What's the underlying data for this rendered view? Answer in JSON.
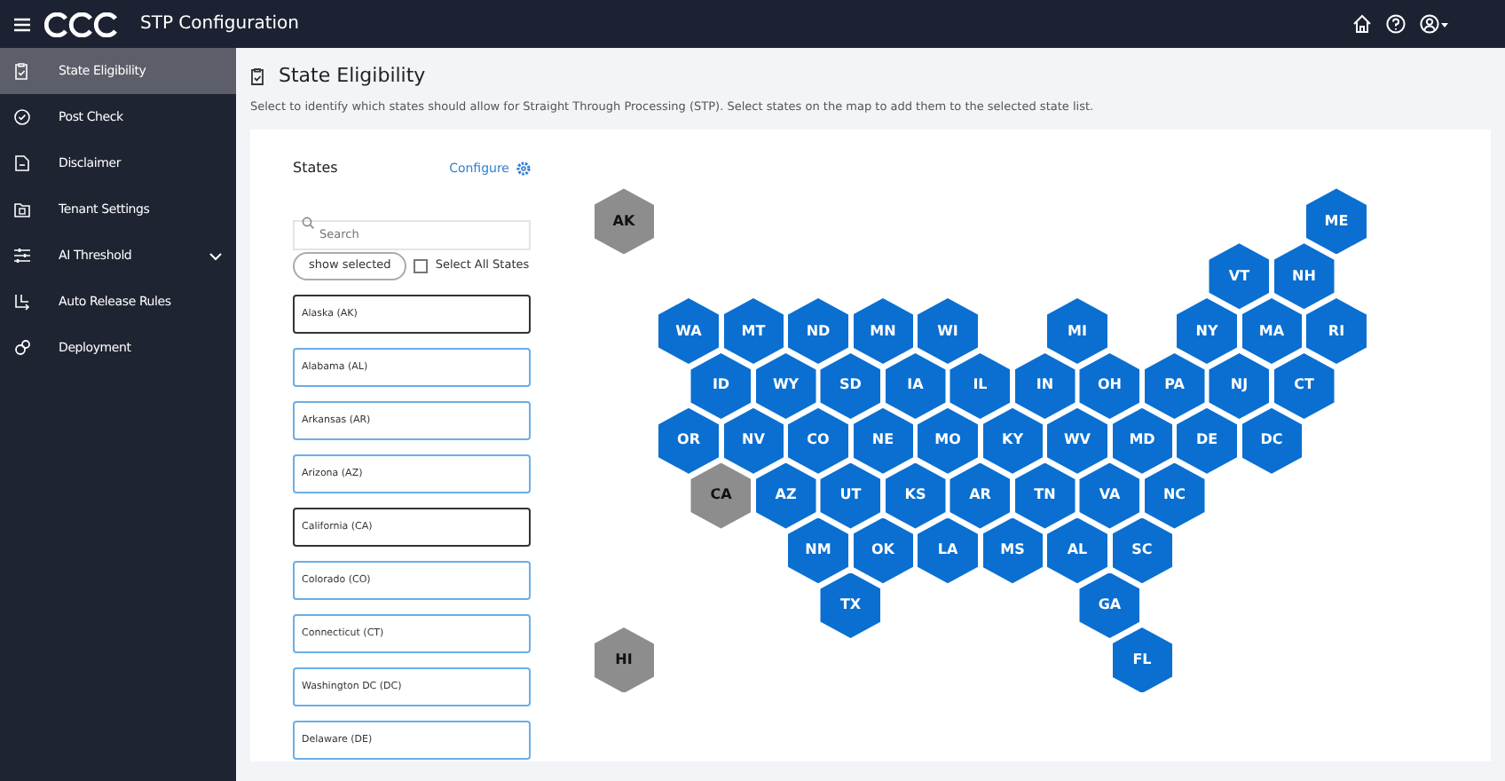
{
  "header": {
    "title": "STP Configuration"
  },
  "sidebar": {
    "items": [
      {
        "label": "State Eligibility",
        "selected": true
      },
      {
        "label": "Post Check",
        "selected": false
      },
      {
        "label": "Disclaimer",
        "selected": false
      },
      {
        "label": "Tenant Settings",
        "selected": false
      },
      {
        "label": "AI Threshold",
        "selected": false,
        "expanded": false
      },
      {
        "label": "Auto Release Rules",
        "selected": false
      },
      {
        "label": "Deployment",
        "selected": false
      }
    ]
  },
  "page": {
    "title": "State Eligibility",
    "description": "Select to identify which states should allow for Straight Through Processing (STP). Select states on the map to add them to the selected state list."
  },
  "states_panel": {
    "title": "States",
    "configure_link": "Configure",
    "search": {
      "placeholder": "Search"
    },
    "show_selected_button": "show selected",
    "select_all": {
      "label": "Select All States",
      "checked": false
    },
    "items": [
      {
        "label": "Alaska (AK)",
        "selected": false
      },
      {
        "label": "Alabama (AL)",
        "selected": true
      },
      {
        "label": "Arkansas (AR)",
        "selected": true
      },
      {
        "label": "Arizona (AZ)",
        "selected": true
      },
      {
        "label": "California (CA)",
        "selected": false
      },
      {
        "label": "Colorado (CO)",
        "selected": true
      },
      {
        "label": "Connecticut (CT)",
        "selected": true
      },
      {
        "label": "Washington DC (DC)",
        "selected": true
      },
      {
        "label": "Delaware (DE)",
        "selected": true
      }
    ]
  },
  "map": {
    "tiles": [
      {
        "code": "AK",
        "selected": false
      },
      {
        "code": "ME",
        "selected": true
      },
      {
        "code": "VT",
        "selected": true
      },
      {
        "code": "NH",
        "selected": true
      },
      {
        "code": "WA",
        "selected": true
      },
      {
        "code": "MT",
        "selected": true
      },
      {
        "code": "ND",
        "selected": true
      },
      {
        "code": "MN",
        "selected": true
      },
      {
        "code": "WI",
        "selected": true
      },
      {
        "code": "MI",
        "selected": true
      },
      {
        "code": "NY",
        "selected": true
      },
      {
        "code": "MA",
        "selected": true
      },
      {
        "code": "RI",
        "selected": true
      },
      {
        "code": "ID",
        "selected": true
      },
      {
        "code": "WY",
        "selected": true
      },
      {
        "code": "SD",
        "selected": true
      },
      {
        "code": "IA",
        "selected": true
      },
      {
        "code": "IL",
        "selected": true
      },
      {
        "code": "IN",
        "selected": true
      },
      {
        "code": "OH",
        "selected": true
      },
      {
        "code": "PA",
        "selected": true
      },
      {
        "code": "NJ",
        "selected": true
      },
      {
        "code": "CT",
        "selected": true
      },
      {
        "code": "OR",
        "selected": true
      },
      {
        "code": "NV",
        "selected": true
      },
      {
        "code": "CO",
        "selected": true
      },
      {
        "code": "NE",
        "selected": true
      },
      {
        "code": "MO",
        "selected": true
      },
      {
        "code": "KY",
        "selected": true
      },
      {
        "code": "WV",
        "selected": true
      },
      {
        "code": "MD",
        "selected": true
      },
      {
        "code": "DE",
        "selected": true
      },
      {
        "code": "DC",
        "selected": true
      },
      {
        "code": "CA",
        "selected": false
      },
      {
        "code": "AZ",
        "selected": true
      },
      {
        "code": "UT",
        "selected": true
      },
      {
        "code": "KS",
        "selected": true
      },
      {
        "code": "AR",
        "selected": true
      },
      {
        "code": "TN",
        "selected": true
      },
      {
        "code": "VA",
        "selected": true
      },
      {
        "code": "NC",
        "selected": true
      },
      {
        "code": "NM",
        "selected": true
      },
      {
        "code": "OK",
        "selected": true
      },
      {
        "code": "LA",
        "selected": true
      },
      {
        "code": "MS",
        "selected": true
      },
      {
        "code": "AL",
        "selected": true
      },
      {
        "code": "SC",
        "selected": true
      },
      {
        "code": "TX",
        "selected": true
      },
      {
        "code": "GA",
        "selected": true
      },
      {
        "code": "HI",
        "selected": false
      },
      {
        "code": "FL",
        "selected": true
      }
    ]
  }
}
